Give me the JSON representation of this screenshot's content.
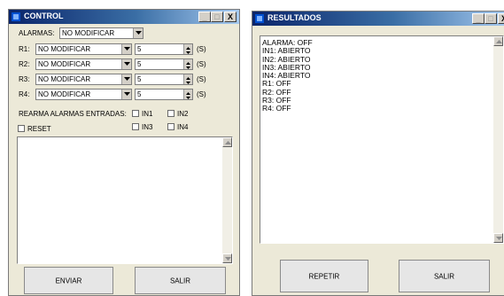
{
  "control": {
    "title": "CONTROL",
    "alarmas_label": "ALARMAS:",
    "alarmas_value": "NO MODIFICAR",
    "relays": [
      {
        "label": "R1:",
        "mode": "NO MODIFICAR",
        "value": "5",
        "unit": "(S)"
      },
      {
        "label": "R2:",
        "mode": "NO MODIFICAR",
        "value": "5",
        "unit": "(S)"
      },
      {
        "label": "R3:",
        "mode": "NO MODIFICAR",
        "value": "5",
        "unit": "(S)"
      },
      {
        "label": "R4:",
        "mode": "NO MODIFICAR",
        "value": "5",
        "unit": "(S)"
      }
    ],
    "rearma_label": "REARMA ALARMAS ENTRADAS:",
    "inputs": [
      "IN1",
      "IN2",
      "IN3",
      "IN4"
    ],
    "reset_label": "RESET",
    "send_button": "ENVIAR",
    "exit_button": "SALIR"
  },
  "results": {
    "title": "RESULTADOS",
    "lines": [
      "ALARMA: OFF",
      "IN1: ABIERTO",
      "IN2: ABIERTO",
      "IN3: ABIERTO",
      "IN4: ABIERTO",
      "R1: OFF",
      "R2: OFF",
      "R3: OFF",
      "R4: OFF"
    ],
    "repeat_button": "REPETIR",
    "exit_button": "SALIR"
  },
  "window_buttons": {
    "minimize": "_",
    "maximize": "□",
    "close": "X"
  }
}
